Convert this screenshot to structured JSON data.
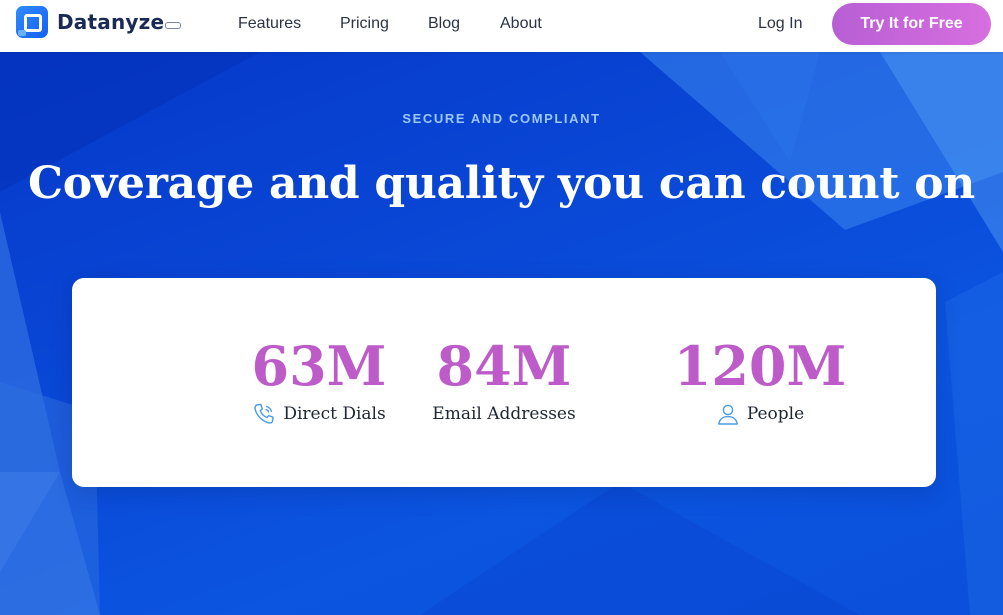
{
  "header": {
    "logo_text": "Datanyze",
    "nav": [
      {
        "label": "Features"
      },
      {
        "label": "Pricing"
      },
      {
        "label": "Blog"
      },
      {
        "label": "About"
      }
    ],
    "login_label": "Log In",
    "cta_label": "Try It for Free"
  },
  "hero": {
    "eyebrow": "SECURE AND COMPLIANT",
    "title": "Coverage and quality you can count on"
  },
  "stats": [
    {
      "value": "63M",
      "label": "Direct Dials",
      "icon": "phone-icon"
    },
    {
      "value": "84M",
      "label": "Email Addresses",
      "icon": ""
    },
    {
      "value": "120M",
      "label": "People",
      "icon": "person-icon"
    }
  ],
  "colors": {
    "accent": "#bd5cc8",
    "cta_start": "#b85ed4",
    "cta_end": "#d76fe0",
    "hero_blue": "#0a4ad8",
    "eyebrow": "#9cc7ff",
    "icon_blue": "#4a9be8"
  }
}
